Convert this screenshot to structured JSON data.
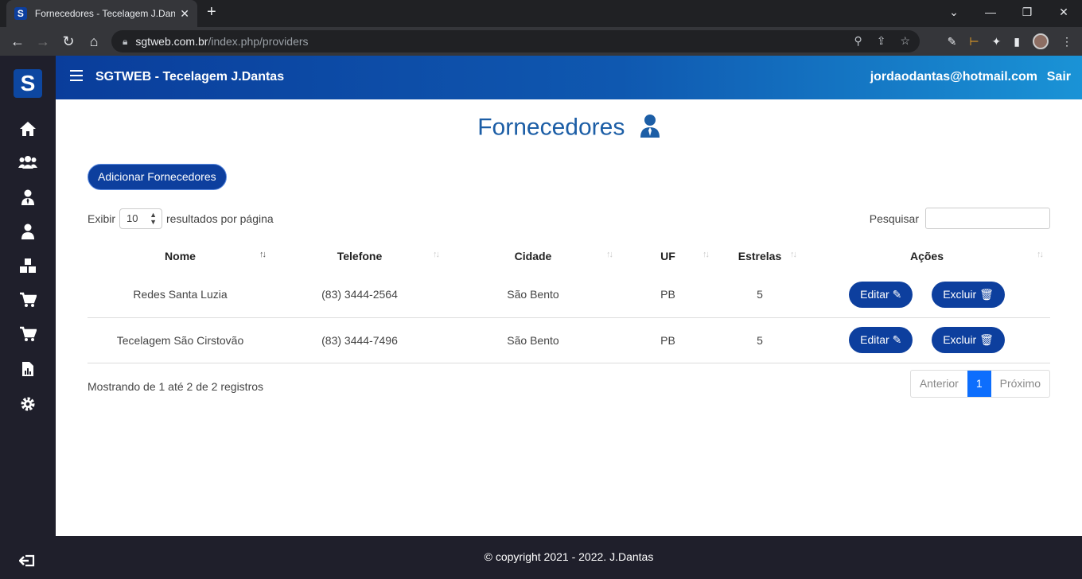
{
  "browser": {
    "tab_title": "Fornecedores - Tecelagem J.Dantas",
    "favicon": "S",
    "url_host": "sgtweb.com.br",
    "url_path": "/index.php/providers"
  },
  "sidebar": {
    "logo": "S",
    "icons": [
      "home-icon",
      "users-icon",
      "user-tie-icon",
      "user-icon",
      "boxes-icon",
      "cart-icon",
      "cart-plus-icon",
      "report-icon",
      "gear-icon"
    ]
  },
  "header": {
    "title": "SGTWEB - Tecelagem J.Dantas",
    "user_email": "jordaodantas@hotmail.com",
    "logout": "Sair"
  },
  "page": {
    "title": "Fornecedores",
    "add_button": "Adicionar Fornecedores",
    "length_prefix": "Exibir",
    "length_value": "10",
    "length_suffix": "resultados por página",
    "search_label": "Pesquisar",
    "columns": [
      "Nome",
      "Telefone",
      "Cidade",
      "UF",
      "Estrelas",
      "Ações"
    ],
    "rows": [
      {
        "nome": "Redes Santa Luzia",
        "telefone": "(83) 3444-2564",
        "cidade": "São Bento",
        "uf": "PB",
        "estrelas": "5"
      },
      {
        "nome": "Tecelagem São Cirstovão",
        "telefone": "(83) 3444-7496",
        "cidade": "São Bento",
        "uf": "PB",
        "estrelas": "5"
      }
    ],
    "edit_label": "Editar",
    "delete_label": "Excluir",
    "info": "Mostrando de 1 até 2 de 2 registros",
    "pager": {
      "prev": "Anterior",
      "current": "1",
      "next": "Próximo"
    }
  },
  "footer": {
    "copyright": "© copyright 2021 - 2022. J.Dantas"
  },
  "colors": {
    "header_start": "#0a3d9b",
    "header_end": "#1a93d6",
    "button": "#0d3f9e",
    "sidebar": "#1f1f2b",
    "title": "#1c5ea6"
  }
}
